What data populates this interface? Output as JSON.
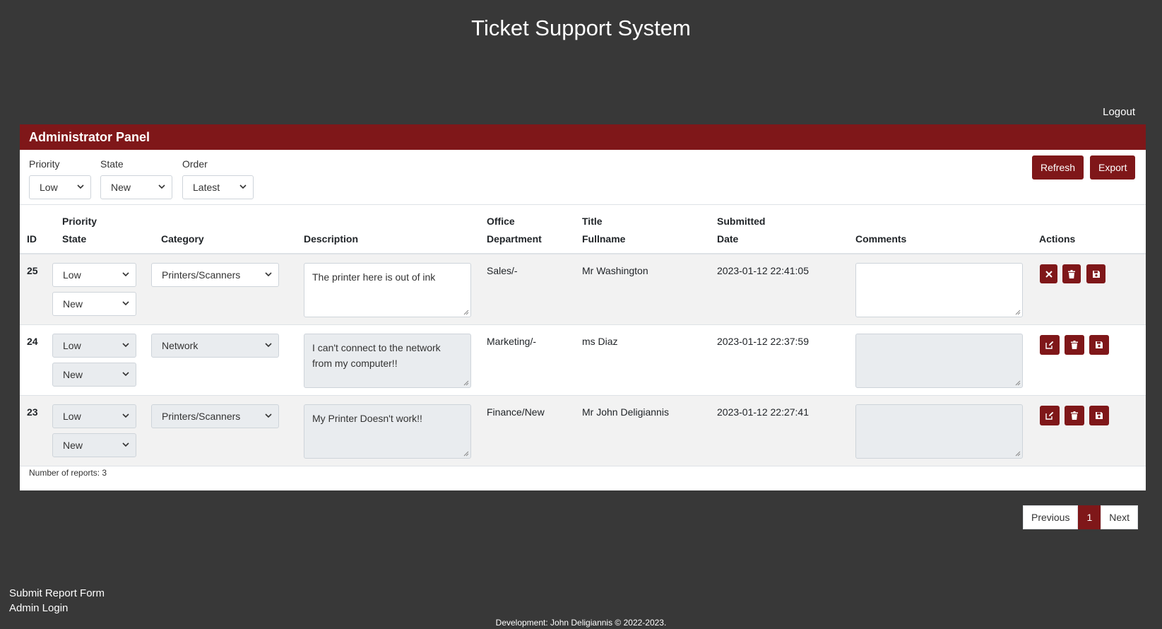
{
  "site": {
    "title": "Ticket Support System",
    "logout": "Logout",
    "credit": "Development: John Deligiannis © 2022-2023."
  },
  "panel": {
    "title": "Administrator Panel",
    "filters": [
      {
        "label": "Priority",
        "value": "Low"
      },
      {
        "label": "State",
        "value": "New"
      },
      {
        "label": "Order",
        "value": "Latest"
      }
    ],
    "refresh_label": "Refresh",
    "export_label": "Export"
  },
  "table": {
    "headers": {
      "id": "ID",
      "priority": "Priority",
      "state": "State",
      "category": "Category",
      "description": "Description",
      "office": "Office",
      "department": "Department",
      "title": "Title",
      "fullname": "Fullname",
      "submitted": "Submitted",
      "date": "Date",
      "comments": "Comments",
      "actions": "Actions"
    },
    "rows": [
      {
        "id": "25",
        "priority": "Low",
        "state": "New",
        "category": "Printers/Scanners",
        "description": "The printer here is out of ink",
        "office": "Sales/-",
        "name": "Mr Washington",
        "date": "2023-01-12 22:41:05",
        "comment": ""
      },
      {
        "id": "24",
        "priority": "Low",
        "state": "New",
        "category": "Network",
        "description": "I can't connect to the network from my computer!!",
        "office": "Marketing/-",
        "name": "ms Diaz",
        "date": "2023-01-12 22:37:59",
        "comment": ""
      },
      {
        "id": "23",
        "priority": "Low",
        "state": "New",
        "category": "Printers/Scanners",
        "description": "My Printer Doesn't work!!",
        "office": "Finance/New",
        "name": "Mr John Deligiannis",
        "date": "2023-01-12 22:27:41",
        "comment": ""
      }
    ],
    "count_text": "Number of reports: 3"
  },
  "pagination": {
    "previous": "Previous",
    "page": "1",
    "next": "Next"
  },
  "footer": {
    "submit_link": "Submit Report Form",
    "admin_link": "Admin Login"
  },
  "colors": {
    "accent": "#7f1719",
    "background": "#383838"
  },
  "icons": {
    "cancel": "close-icon",
    "delete": "trash-icon",
    "save": "save-icon",
    "edit": "edit-icon",
    "dropdown": "chevron-down-icon"
  }
}
